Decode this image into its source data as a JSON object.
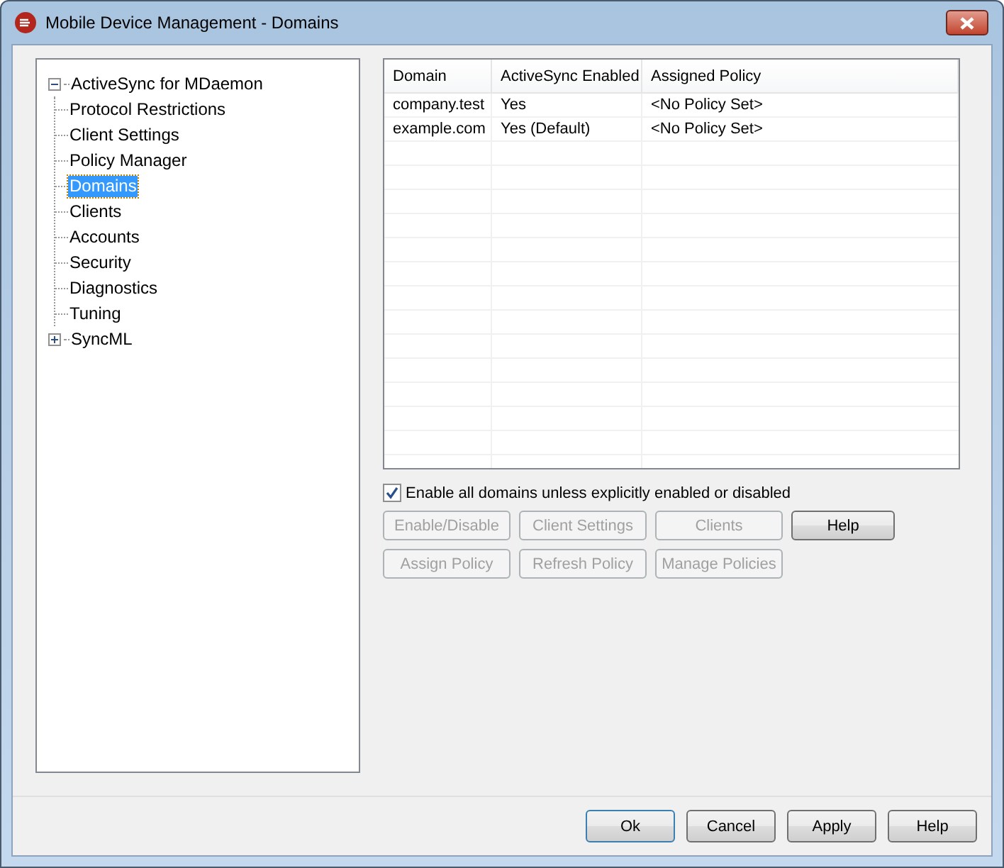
{
  "window": {
    "title": "Mobile Device Management - Domains"
  },
  "tree": [
    {
      "label": "ActiveSync for MDaemon",
      "expanded": true,
      "selected": false,
      "children": [
        {
          "label": "Protocol Restrictions",
          "selected": false
        },
        {
          "label": "Client Settings",
          "selected": false
        },
        {
          "label": "Policy Manager",
          "selected": false
        },
        {
          "label": "Domains",
          "selected": true
        },
        {
          "label": "Clients",
          "selected": false
        },
        {
          "label": "Accounts",
          "selected": false
        },
        {
          "label": "Security",
          "selected": false
        },
        {
          "label": "Diagnostics",
          "selected": false
        },
        {
          "label": "Tuning",
          "selected": false
        }
      ]
    },
    {
      "label": "SyncML",
      "expanded": false,
      "selected": false
    }
  ],
  "table": {
    "columns": [
      "Domain",
      "ActiveSync Enabled",
      "Assigned Policy"
    ],
    "rows": [
      [
        "company.test",
        "Yes",
        "<No Policy Set>"
      ],
      [
        "example.com",
        "Yes (Default)",
        "<No Policy Set>"
      ]
    ]
  },
  "enable_all": {
    "label": "Enable all domains unless explicitly enabled or disabled",
    "checked": true
  },
  "actions": [
    {
      "label": "Enable/Disable",
      "disabled": true
    },
    {
      "label": "Client Settings",
      "disabled": true
    },
    {
      "label": "Clients",
      "disabled": true
    },
    {
      "label": "Help",
      "disabled": false
    },
    {
      "label": "Assign Policy",
      "disabled": true
    },
    {
      "label": "Refresh Policy",
      "disabled": true
    },
    {
      "label": "Manage Policies",
      "disabled": true
    }
  ],
  "footer_buttons": [
    {
      "label": "Ok",
      "default": true
    },
    {
      "label": "Cancel",
      "default": false
    },
    {
      "label": "Apply",
      "default": false
    },
    {
      "label": "Help",
      "default": false
    }
  ]
}
